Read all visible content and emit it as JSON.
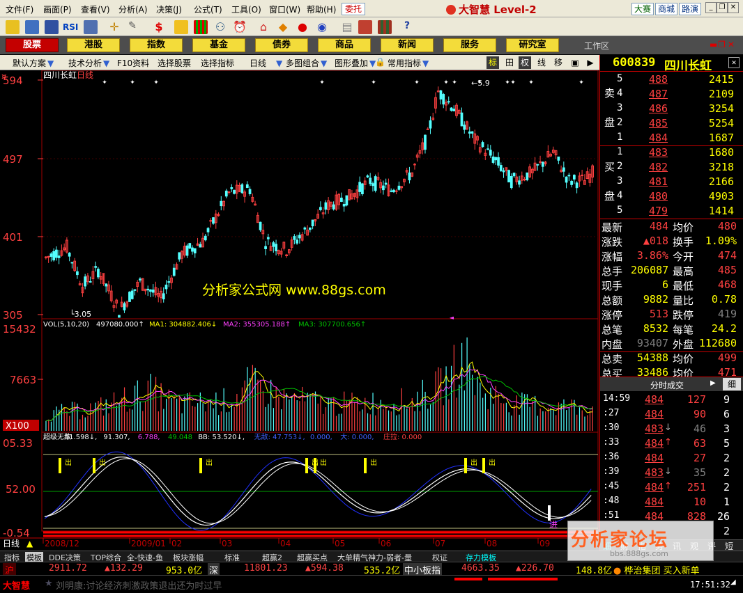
{
  "menu": [
    "文件(F)",
    "画面(P)",
    "查看(V)",
    "分析(A)",
    "决策(J)",
    "公式(T)",
    "工具(O)",
    "窗口(W)",
    "帮助(H)"
  ],
  "delegate_btn": "委托",
  "app_title": "大智慧 Level-2",
  "top_links": [
    "大赛",
    "商城",
    "路演"
  ],
  "nav": [
    "股票",
    "港股",
    "指数",
    "基金",
    "债券",
    "商品",
    "新闻",
    "服务",
    "研究室"
  ],
  "workspace": "工作区",
  "subbar": [
    "默认方案",
    "技术分析",
    "F10资料",
    "选择股票",
    "选择指标",
    "日线",
    "多图组合",
    "图形叠加",
    "常用指标"
  ],
  "toggles": [
    "标",
    "田",
    "权",
    "线",
    "移",
    "▣",
    "▶"
  ],
  "stock": {
    "code": "600839",
    "name": "四川长虹",
    "title": "四川长虹",
    "period": "日线"
  },
  "price_axis": [
    "594",
    "497",
    "401",
    "305"
  ],
  "price_marks": {
    "high": "5.9",
    "low": "3.05"
  },
  "watermark": "分析家公式网 www.88gs.com",
  "vol_legend": {
    "label": "VOL(5,10,20)",
    "vol": "497080.000↑",
    "ma1": "MA1: 304882.406↓",
    "ma2": "MA2: 355305.188↑",
    "ma3": "MA3: 307700.656↑"
  },
  "vol_axis": [
    "15432",
    "7663",
    "X100"
  ],
  "ind_legend": {
    "name": "超级无敌",
    "v1": "51.598↓,",
    "v2": "91.307,",
    "v3": "6.788,",
    "v4": "49.048",
    "bb": "BB: 53.520↓,",
    "wd": "无敌: 47.753↓,",
    "z": "0.000,",
    "da": "大: 0.000,",
    "zl": "庄拉: 0.000"
  },
  "ind_axis": [
    "05.33",
    "52.00",
    "-0.54"
  ],
  "buy_label": "进",
  "sell_label": "出",
  "x_axis": [
    "2008/12",
    "2009/01",
    "02",
    "03",
    "04",
    "05",
    "06",
    "07",
    "08",
    "09"
  ],
  "period_label": "日线",
  "order_book": {
    "sell_label": [
      "卖",
      "盘"
    ],
    "buy_label": [
      "买",
      "盘"
    ],
    "sells": [
      {
        "n": "5",
        "p": "488",
        "v": "2415"
      },
      {
        "n": "4",
        "p": "487",
        "v": "2109"
      },
      {
        "n": "3",
        "p": "486",
        "v": "3254"
      },
      {
        "n": "2",
        "p": "485",
        "v": "5254"
      },
      {
        "n": "1",
        "p": "484",
        "v": "1687"
      }
    ],
    "buys": [
      {
        "n": "1",
        "p": "483",
        "v": "1680"
      },
      {
        "n": "2",
        "p": "482",
        "v": "3218"
      },
      {
        "n": "3",
        "p": "481",
        "v": "2166"
      },
      {
        "n": "4",
        "p": "480",
        "v": "4903"
      },
      {
        "n": "5",
        "p": "479",
        "v": "1414"
      }
    ]
  },
  "quote": [
    {
      "l1": "最新",
      "v1": "484",
      "l2": "均价",
      "v2": "480"
    },
    {
      "l1": "涨跌",
      "v1": "▲018",
      "l2": "换手",
      "v2": "1.09%"
    },
    {
      "l1": "涨幅",
      "v1": "3.86%",
      "l2": "今开",
      "v2": "474"
    },
    {
      "l1": "总手",
      "v1": "206087",
      "l2": "最高",
      "v2": "485"
    },
    {
      "l1": "现手",
      "v1": "6",
      "l2": "最低",
      "v2": "468"
    },
    {
      "l1": "总额",
      "v1": "9882",
      "l2": "量比",
      "v2": "0.78"
    },
    {
      "l1": "涨停",
      "v1": "513",
      "l2": "跌停",
      "v2": "419"
    },
    {
      "l1": "总笔",
      "v1": "8532",
      "l2": "每笔",
      "v2": "24.2"
    },
    {
      "l1": "内盘",
      "v1": "93407",
      "l2": "外盘",
      "v2": "112680"
    },
    {
      "l1": "总卖",
      "v1": "54388",
      "l2": "均价",
      "v2": "499"
    },
    {
      "l1": "总买",
      "v1": "33486",
      "l2": "均价",
      "v2": "471"
    }
  ],
  "tick_header": "分时成交",
  "tick_header_btn": "细",
  "ticks": [
    {
      "t": "14:59",
      "p": "484",
      "a": "",
      "v": "127",
      "c": "9"
    },
    {
      "t": ":27",
      "p": "484",
      "a": "",
      "v": "90",
      "c": "6"
    },
    {
      "t": ":30",
      "p": "483",
      "a": "↓",
      "v": "46",
      "c": "3"
    },
    {
      "t": ":33",
      "p": "484",
      "a": "↑",
      "v": "63",
      "c": "5"
    },
    {
      "t": ":36",
      "p": "484",
      "a": "",
      "v": "27",
      "c": "2"
    },
    {
      "t": ":39",
      "p": "483",
      "a": "↓",
      "v": "35",
      "c": "2"
    },
    {
      "t": ":45",
      "p": "484",
      "a": "↑",
      "v": "251",
      "c": "2"
    },
    {
      "t": ":48",
      "p": "484",
      "a": "",
      "v": "10",
      "c": "1"
    },
    {
      "t": ":51",
      "p": "484",
      "a": "",
      "v": "828",
      "c": "26"
    },
    {
      "t": "",
      "p": "",
      "a": "",
      "v": "",
      "c": "2"
    }
  ],
  "right_tabs": [
    "细",
    "财",
    "指",
    "势",
    "讯",
    "观",
    "评",
    "短"
  ],
  "bottom_tabs": [
    "指标",
    "模板",
    "DDE决策",
    "TOP综合",
    "全-快速-鱼",
    "板块涨幅",
    "标准",
    "超赢2",
    "超赢买点",
    "大单精气神力-弱者-量",
    "权证",
    "存力模板"
  ],
  "status1": {
    "sh_label": "沪",
    "sh_val": "2911.72",
    "sh_chg": "▲132.29",
    "sh_amt": "953.0亿",
    "sz_label": "深",
    "sz_val": "11801.23",
    "sz_chg": "▲594.38",
    "sz_amt": "535.2亿",
    "zx_label": "中小板指",
    "zx_val": "4663.35",
    "zx_chg": "▲226.70",
    "zx_amt": "148.8亿",
    "news": "桦治集团 买入新单"
  },
  "status2": {
    "brand": "大智慧",
    "ticker": "刘明康:讨论经济刺激政策退出还为时过早",
    "time": "17:51:32"
  },
  "forum_watermark": "分析家论坛",
  "forum_sub": "bbs.888gs.com",
  "colors": {
    "up": "#ff4040",
    "down": "#54ffff",
    "yellow": "#ffff00",
    "magenta": "#ff40ff",
    "green": "#00c000",
    "axis": "#c00000"
  }
}
